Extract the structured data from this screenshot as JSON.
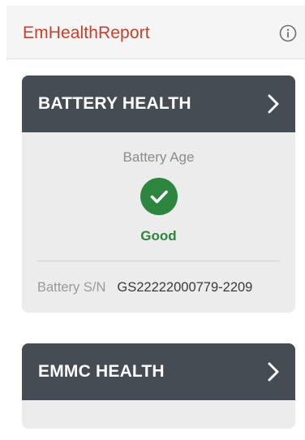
{
  "app": {
    "title": "EmHealthReport",
    "info_icon": "info-circle-icon"
  },
  "battery_card": {
    "title": "BATTERY HEALTH",
    "chevron_icon": "chevron-right-icon",
    "age_label": "Battery Age",
    "status_icon": "checkmark-circle-icon",
    "status": "Good",
    "sn_label": "Battery S/N",
    "sn_value": "GS22222000779-2209"
  },
  "emmc_card": {
    "title": "EMMC HEALTH",
    "chevron_icon": "chevron-right-icon"
  },
  "colors": {
    "accent": "#c8402a",
    "header": "#464c54",
    "good": "#2e8540",
    "card_bg": "#ececec"
  }
}
